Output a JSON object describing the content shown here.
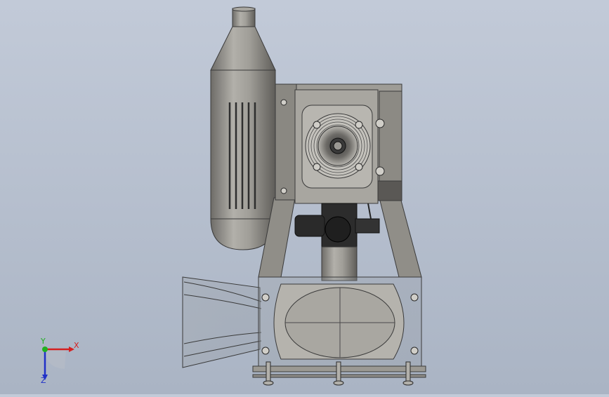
{
  "viewport": {
    "background_top": "#c2cad8",
    "background_bottom": "#aab4c4",
    "model_metal_color": "#8f8d88",
    "model_dark_color": "#2c2c2c"
  },
  "triad": {
    "x_label": "X",
    "y_label": "Y",
    "z_label": "Z",
    "x_color": "#d42020",
    "y_color": "#20b020",
    "z_color": "#2030c8"
  }
}
